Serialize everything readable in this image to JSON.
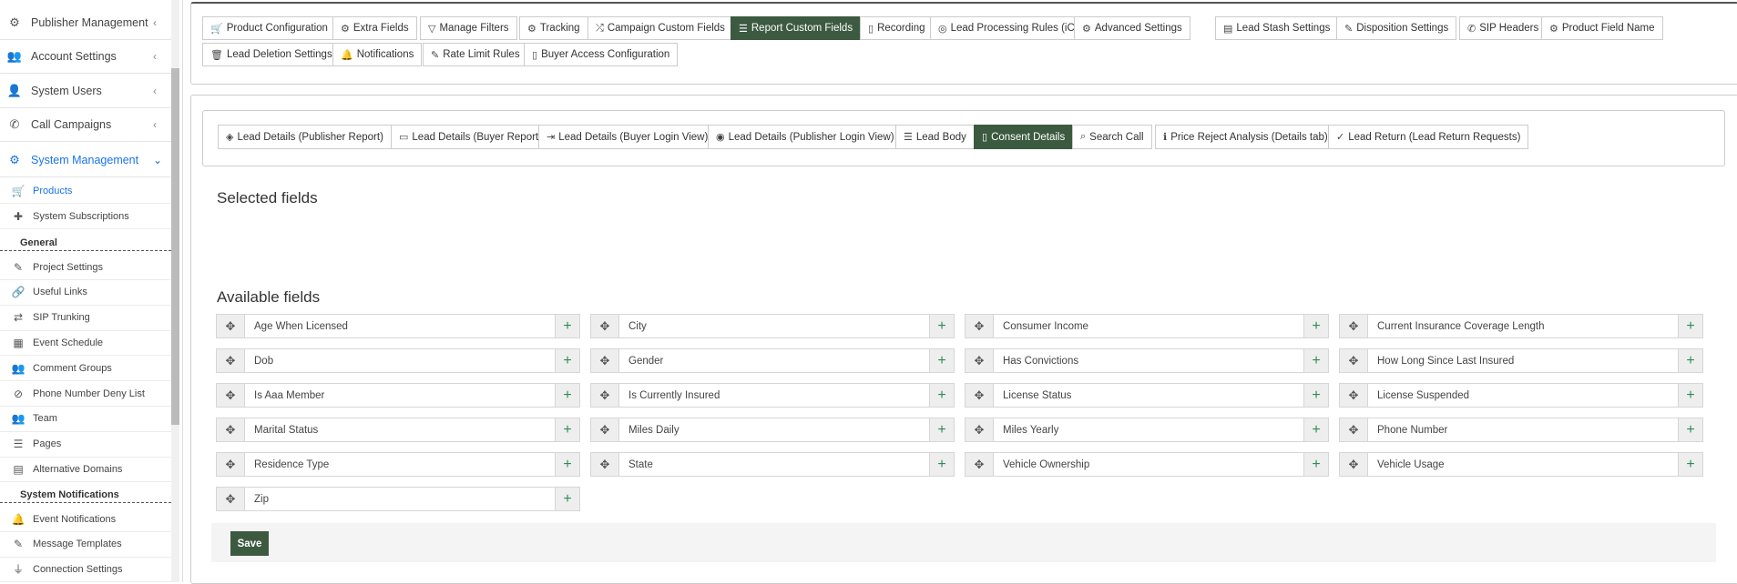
{
  "sidebar": {
    "items": [
      {
        "label": "Publisher Management",
        "icon": "users-cog-icon",
        "glyph": "⚙"
      },
      {
        "label": "Account Settings",
        "icon": "users-icon",
        "glyph": "👥"
      },
      {
        "label": "System Users",
        "icon": "user-icon",
        "glyph": "👤"
      },
      {
        "label": "Call Campaigns",
        "icon": "phone-icon",
        "glyph": "✆"
      },
      {
        "label": "System Management",
        "icon": "cogs-icon",
        "glyph": "⚙"
      }
    ],
    "sub_items": [
      {
        "label": "Products",
        "icon": "cart-icon",
        "glyph": "🛒"
      },
      {
        "label": "System Subscriptions",
        "icon": "puzzle-icon",
        "glyph": "✚"
      }
    ],
    "group_general": "General",
    "general_items": [
      {
        "label": "Project Settings",
        "icon": "magic-wand-icon",
        "glyph": "✎"
      },
      {
        "label": "Useful Links",
        "icon": "link-icon",
        "glyph": "🔗"
      },
      {
        "label": "SIP Trunking",
        "icon": "exchange-icon",
        "glyph": "⇄"
      },
      {
        "label": "Event Schedule",
        "icon": "calendar-icon",
        "glyph": "▦"
      },
      {
        "label": "Comment Groups",
        "icon": "users-icon",
        "glyph": "👥"
      },
      {
        "label": "Phone Number Deny List",
        "icon": "ban-icon",
        "glyph": "⊘"
      },
      {
        "label": "Team",
        "icon": "users-icon",
        "glyph": "👥"
      },
      {
        "label": "Pages",
        "icon": "list-icon",
        "glyph": "☰"
      },
      {
        "label": "Alternative Domains",
        "icon": "server-icon",
        "glyph": "▤"
      }
    ],
    "group_notifications": "System Notifications",
    "notification_items": [
      {
        "label": "Event Notifications",
        "icon": "bell-icon",
        "glyph": "🔔"
      },
      {
        "label": "Message Templates",
        "icon": "pencil-icon",
        "glyph": "✎"
      },
      {
        "label": "Connection Settings",
        "icon": "plug-icon",
        "glyph": "⏚"
      }
    ]
  },
  "top_tabs": [
    {
      "label": "Product Configuration",
      "glyph": "🛒"
    },
    {
      "label": "Extra Fields",
      "glyph": "⚙"
    },
    {
      "label": "Manage Filters",
      "glyph": "▽"
    },
    {
      "label": "Tracking",
      "glyph": "⚙"
    },
    {
      "label": "Campaign Custom Fields",
      "glyph": "⤮"
    },
    {
      "label": "Report Custom Fields",
      "glyph": "☰"
    },
    {
      "label": "Recording",
      "glyph": "▯"
    },
    {
      "label": "Lead Processing Rules (iClear)",
      "glyph": "◎"
    },
    {
      "label": "Advanced Settings",
      "glyph": "⚙"
    },
    {
      "label": "Lead Stash Settings",
      "glyph": "▤"
    },
    {
      "label": "Disposition Settings",
      "glyph": "✎"
    },
    {
      "label": "SIP Headers",
      "glyph": "✆"
    },
    {
      "label": "Product Field Name",
      "glyph": "⚙"
    },
    {
      "label": "Lead Deletion Settings",
      "glyph": "🗑"
    },
    {
      "label": "Notifications",
      "glyph": "🔔"
    },
    {
      "label": "Rate Limit Rules",
      "glyph": "✎"
    },
    {
      "label": "Buyer Access Configuration",
      "glyph": "▯"
    }
  ],
  "sub_tabs": [
    {
      "label": "Lead Details (Publisher Report)",
      "glyph": "◈"
    },
    {
      "label": "Lead Details (Buyer Report)",
      "glyph": "▭"
    },
    {
      "label": "Lead Details (Buyer Login View)",
      "glyph": "⇥"
    },
    {
      "label": "Lead Details (Publisher Login View)",
      "glyph": "◉"
    },
    {
      "label": "Lead Body",
      "glyph": "☰"
    },
    {
      "label": "Consent Details",
      "glyph": "▯"
    },
    {
      "label": "Search Call",
      "glyph": "⌕"
    },
    {
      "label": "Price Reject Analysis (Details tab)",
      "glyph": "ℹ"
    },
    {
      "label": "Lead Return (Lead Return Requests)",
      "glyph": "✓"
    }
  ],
  "selected_title": "Selected fields",
  "available_title": "Available fields",
  "available_fields": [
    "Age When Licensed",
    "City",
    "Consumer Income",
    "Current Insurance Coverage Length",
    "Dob",
    "Gender",
    "Has Convictions",
    "How Long Since Last Insured",
    "Is Aaa Member",
    "Is Currently Insured",
    "License Status",
    "License Suspended",
    "Marital Status",
    "Miles Daily",
    "Miles Yearly",
    "Phone Number",
    "Residence Type",
    "State",
    "Vehicle Ownership",
    "Vehicle Usage",
    "Zip"
  ],
  "drag_glyph": "✥",
  "add_glyph": "+",
  "save_label": "Save",
  "chevron_left": "‹",
  "chevron_down": "⌄"
}
